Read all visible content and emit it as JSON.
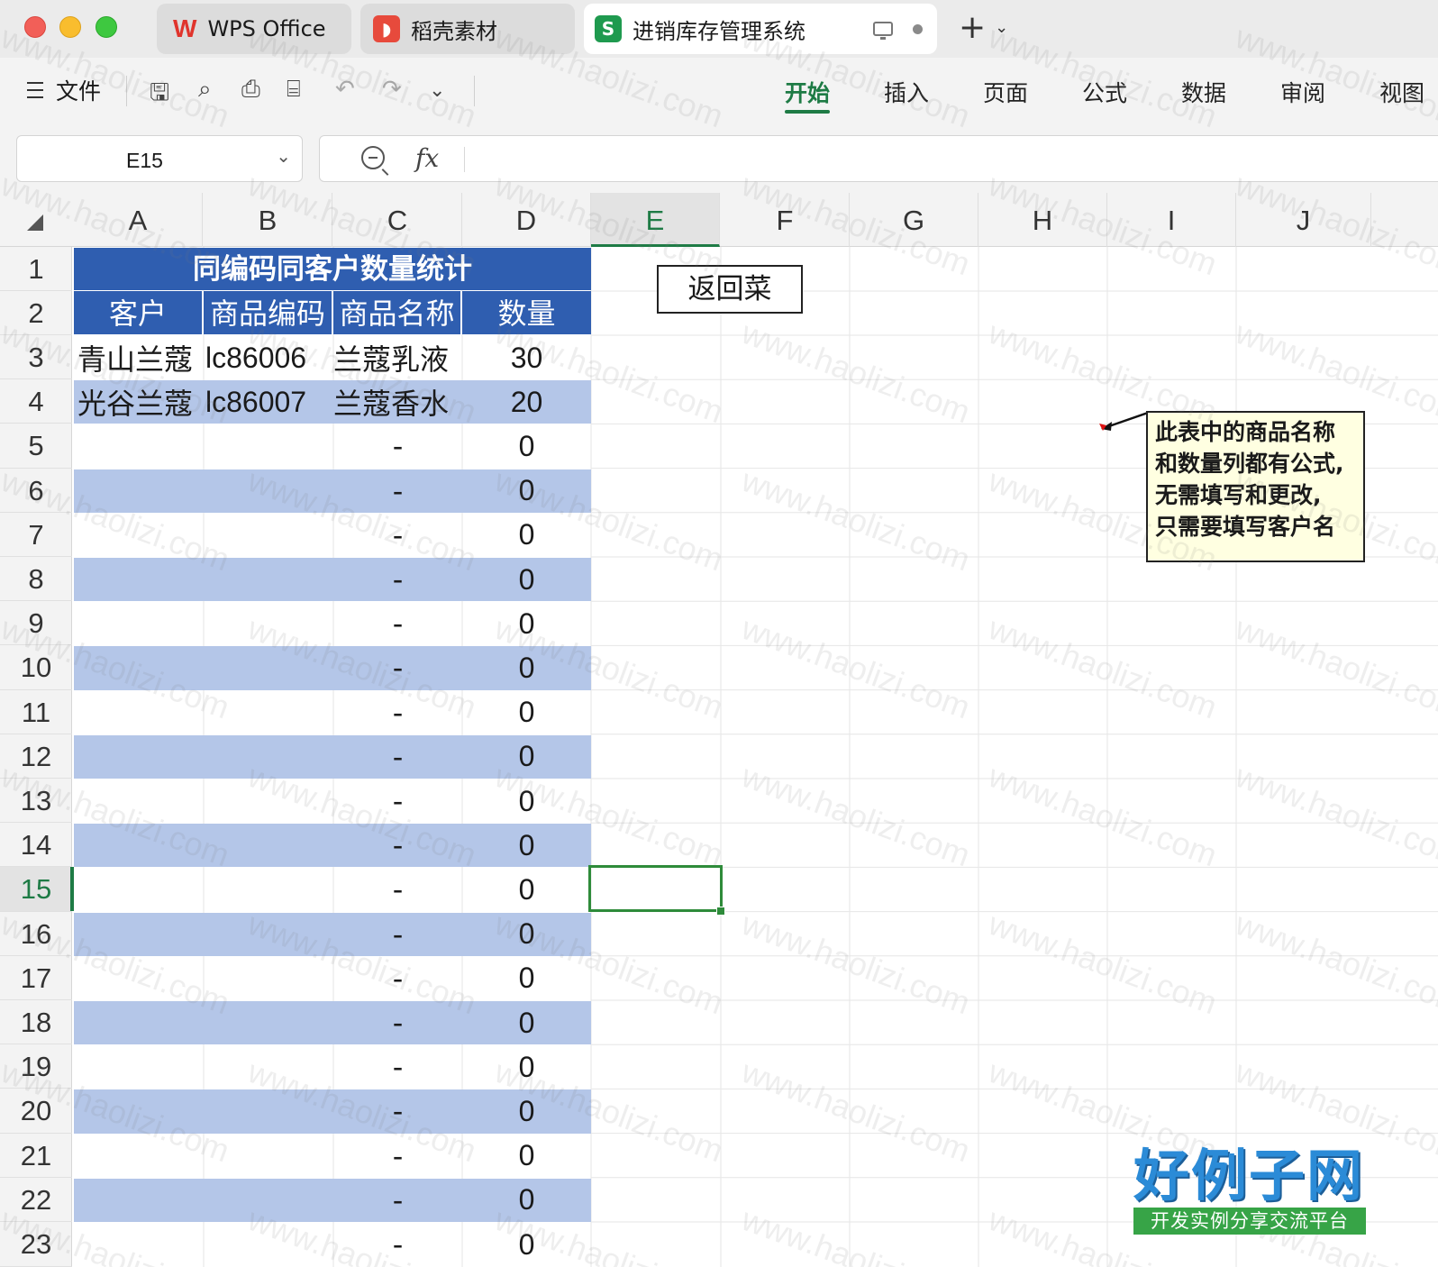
{
  "window": {
    "tabs": [
      {
        "label": "WPS Office",
        "icon": "wps-logo-icon"
      },
      {
        "label": "稻壳素材",
        "icon": "daoke-icon"
      },
      {
        "label": "进销库存管理系统",
        "icon": "spreadsheet-icon",
        "active": true
      }
    ],
    "new_tab_symbol": "+"
  },
  "menu": {
    "file_label": "文件",
    "ribbon_tabs": [
      "开始",
      "插入",
      "页面",
      "公式",
      "数据",
      "审阅",
      "视图"
    ],
    "active_tab": "开始"
  },
  "formula_bar": {
    "name_box": "E15",
    "fx_label": "fx",
    "formula": ""
  },
  "grid": {
    "columns": [
      "A",
      "B",
      "C",
      "D",
      "E",
      "F",
      "G",
      "H",
      "I",
      "J"
    ],
    "selected_column": "E",
    "rows": [
      "1",
      "2",
      "3",
      "4",
      "5",
      "6",
      "7",
      "8",
      "9",
      "10",
      "11",
      "12",
      "13",
      "14",
      "15",
      "16",
      "17",
      "18",
      "19",
      "20",
      "21",
      "22",
      "23"
    ],
    "selected_row": "15"
  },
  "table": {
    "title": "同编码同客户数量统计",
    "headers": [
      "客户",
      "商品编码",
      "商品名称",
      "数量"
    ],
    "rows": [
      [
        "青山兰蔻",
        "lc86006",
        "兰蔻乳液",
        "30"
      ],
      [
        "光谷兰蔻",
        "lc86007",
        "兰蔻香水",
        "20"
      ],
      [
        "",
        "",
        "-",
        "0"
      ],
      [
        "",
        "",
        "-",
        "0"
      ],
      [
        "",
        "",
        "-",
        "0"
      ],
      [
        "",
        "",
        "-",
        "0"
      ],
      [
        "",
        "",
        "-",
        "0"
      ],
      [
        "",
        "",
        "-",
        "0"
      ],
      [
        "",
        "",
        "-",
        "0"
      ],
      [
        "",
        "",
        "-",
        "0"
      ],
      [
        "",
        "",
        "-",
        "0"
      ],
      [
        "",
        "",
        "-",
        "0"
      ],
      [
        "",
        "",
        "-",
        "0"
      ],
      [
        "",
        "",
        "-",
        "0"
      ],
      [
        "",
        "",
        "-",
        "0"
      ],
      [
        "",
        "",
        "-",
        "0"
      ],
      [
        "",
        "",
        "-",
        "0"
      ],
      [
        "",
        "",
        "-",
        "0"
      ],
      [
        "",
        "",
        "-",
        "0"
      ],
      [
        "",
        "",
        "-",
        "0"
      ],
      [
        "",
        "",
        "-",
        "0"
      ]
    ]
  },
  "back_button": {
    "label": "返回菜"
  },
  "note": {
    "lines": [
      "此表中的商品名称",
      "和数量列都有公式,",
      "无需填写和更改,",
      "只需要填写客户名"
    ]
  },
  "watermark": {
    "text": "www.haolizi.com"
  },
  "logo": {
    "main": "好例子网",
    "sub": "开发实例分享交流平台"
  },
  "colors": {
    "header_blue": "#2f5eb0",
    "band_blue": "#b4c6e8",
    "accent_green": "#1e7b45",
    "note_bg": "#ffffe1"
  }
}
